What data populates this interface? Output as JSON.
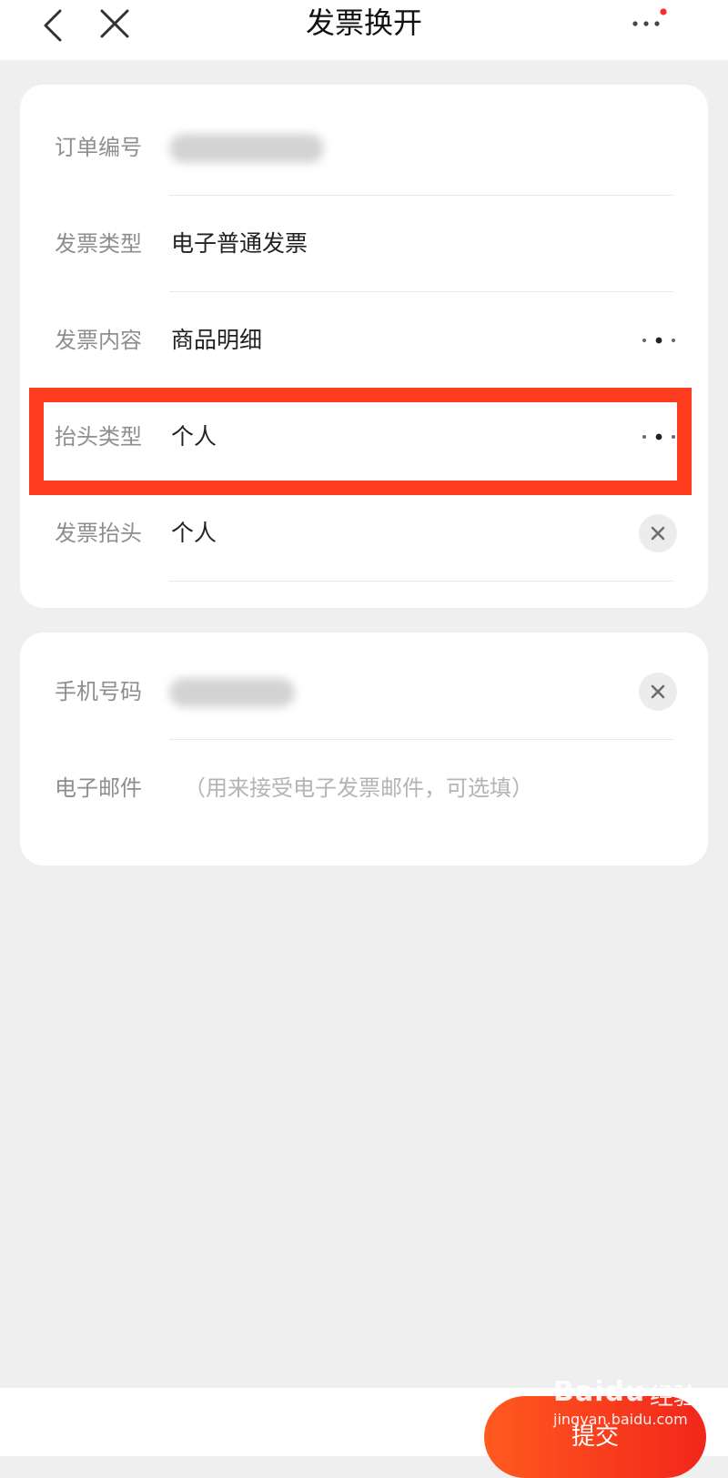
{
  "header": {
    "title": "发票换开"
  },
  "invoice_form": {
    "rows": [
      {
        "label": "订单编号",
        "value": ""
      },
      {
        "label": "发票类型",
        "value": "电子普通发票"
      },
      {
        "label": "发票内容",
        "value": "商品明细"
      },
      {
        "label": "抬头类型",
        "value": "个人"
      },
      {
        "label": "发票抬头",
        "value": "个人"
      }
    ]
  },
  "contact_form": {
    "phone_label": "手机号码",
    "email_label": "电子邮件",
    "email_placeholder": "（用来接受电子发票邮件，可选填）"
  },
  "footer": {
    "submit_label": "提交"
  },
  "watermark": {
    "brand": "Baidu",
    "product": "经验",
    "url": "jingyan.baidu.com"
  },
  "colors": {
    "highlight": "#ff3d1e",
    "submit_button": "#f2261b",
    "notification_dot": "#ff2a2a"
  }
}
